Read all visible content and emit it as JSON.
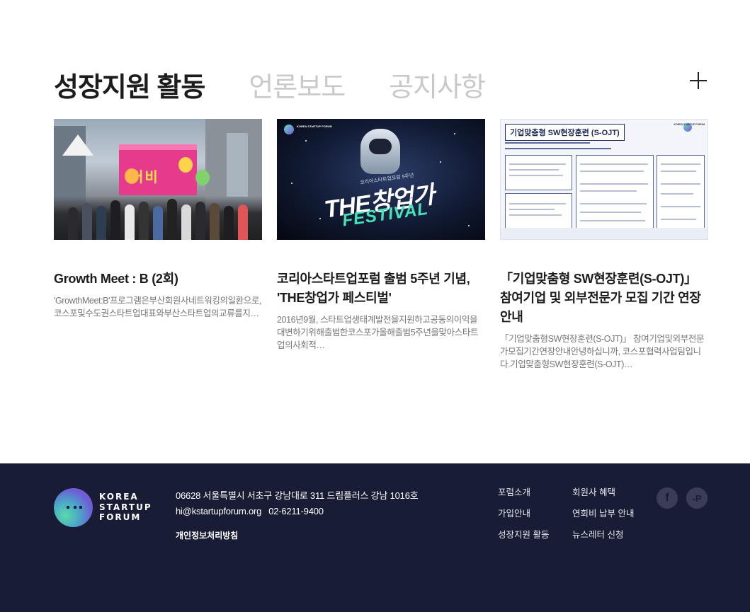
{
  "tabs": [
    {
      "label": "성장지원 활동"
    },
    {
      "label": "언론보도"
    },
    {
      "label": "공지사항"
    }
  ],
  "cards": [
    {
      "image_sign": "커비",
      "title": "Growth Meet : B (2회)",
      "desc": "'GrowthMeet:B'프로그램은부산회원사네트워킹의일환으로, 코스포및수도권스타트업대표와부산스타트업의교류를지…"
    },
    {
      "image_sub": "코리아스타트업포럼 5주년",
      "image_big": "THE창업가",
      "image_fest": "FESTIVAL",
      "image_logo": "KOREA STARTUP FORUM",
      "title": "코리아스타트업포럼 출범 5주년 기념, 'THE창업가 페스티벌'",
      "desc": "2016년9월, 스타트업생태계발전을지원하고공동의이익을대변하기위해출범한코스포가올해출범5주년을맞아스타트업의사회적…"
    },
    {
      "image_title": "기업맞춤형 SW현장훈련 (S-OJT)",
      "image_logo": "KOREA STARTUP FORUM",
      "title": "「기업맞춤형 SW현장훈련(S-OJT)」 참여기업 및 외부전문가 모집 기간 연장 안내",
      "desc": "「기업맞춤형SW현장훈련(S-OJT)」 참여기업및외부전문가모집기간연장안내안녕하십니까, 코스포협력사업팀입니다.기업맞춤형SW현장훈련(S-OJT)…"
    }
  ],
  "footer": {
    "brand": [
      "KOREA",
      "STARTUP",
      "FORUM"
    ],
    "address": "06628 서울특별시 서초구 강남대로 311 드림플러스 강남 1016호",
    "email": "hi@kstartupforum.org",
    "phone": "02-6211-9400",
    "privacy": "개인정보처리방침",
    "links": [
      "포럼소개",
      "회원사 혜택",
      "가입안내",
      "연회비 납부 안내",
      "성장지원 활동",
      "뉴스레터 신청"
    ],
    "social": [
      {
        "icon": "facebook-icon",
        "glyph": "f"
      },
      {
        "icon": "post-icon",
        "glyph": "-P"
      }
    ]
  },
  "colors": {
    "footer_bg": "#191c35",
    "tab_active": "#1c1c1c",
    "tab_inactive": "#c9c9c9"
  }
}
